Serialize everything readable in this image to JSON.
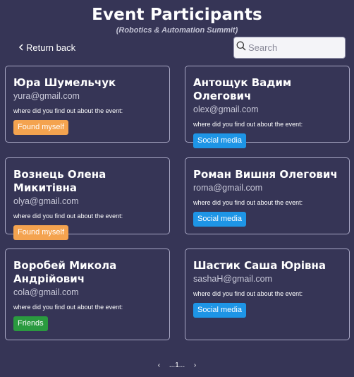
{
  "header": {
    "title": "Event Participants",
    "subtitle": "(Robotics & Automation Summit)"
  },
  "toolbar": {
    "back_label": "Return back",
    "search_placeholder": "Search"
  },
  "colors": {
    "background": "#363556",
    "found_myself": "#f4a34f",
    "social_media": "#1e95e6",
    "friends": "#2a9a3f"
  },
  "participants": [
    {
      "name": "Юра Шумельчук",
      "email": "yura@gmail.com",
      "question": "where did you find out about the event:",
      "source": "Found myself",
      "source_color": "#f4a34f"
    },
    {
      "name": "Антощук Вадим Олегович",
      "email": "olex@gmail.com",
      "question": "where did you find out about the event:",
      "source": "Social media",
      "source_color": "#1e95e6"
    },
    {
      "name": "Вознець Олена Микитівна",
      "email": "olya@gmail.com",
      "question": "where did you find out about the event:",
      "source": "Found myself",
      "source_color": "#f4a34f"
    },
    {
      "name": "Роман Вишня Олегович",
      "email": "roma@gmail.com",
      "question": "where did you find out about the event:",
      "source": "Social media",
      "source_color": "#1e95e6"
    },
    {
      "name": "Воробей Микола Андрійович",
      "email": "cola@gmail.com",
      "question": "where did you find out about the event:",
      "source": "Friends",
      "source_color": "#2a9a3f"
    },
    {
      "name": "Шастик Саша Юрівна",
      "email": "sashaH@gmail.com",
      "question": "where did you find out about the event:",
      "source": "Social media",
      "source_color": "#1e95e6"
    }
  ],
  "pagination": {
    "prev": "‹",
    "pages": "...1...",
    "next": "›"
  }
}
